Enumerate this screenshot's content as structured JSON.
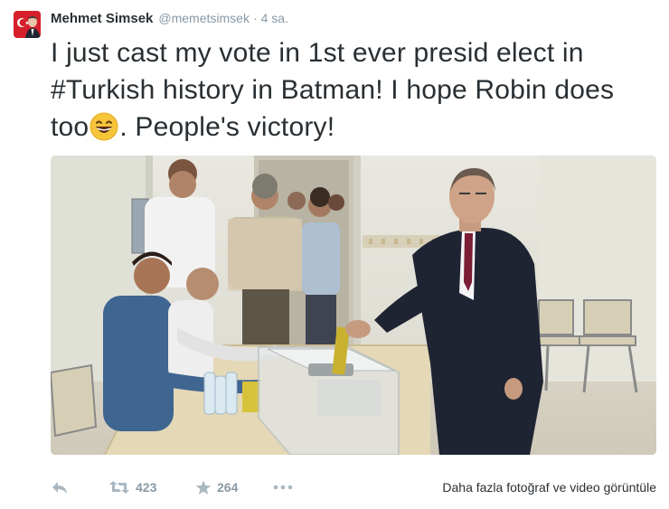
{
  "tweet": {
    "author_name": "Mehmet Simsek",
    "handle": "@memetsimsek",
    "separator": "·",
    "time": "4 sa.",
    "text_before_emoji": "I just cast my vote in 1st ever presid elect in #Turkish history in Batman! I hope Robin does too",
    "emoji": "grinning-face-emoji",
    "text_after_emoji": ". People's victory!"
  },
  "actions": {
    "reply_icon": "reply-icon",
    "retweet_icon": "retweet-icon",
    "retweet_count": "423",
    "favorite_icon": "star-icon",
    "favorite_count": "264",
    "more_icon": "more-icon",
    "more_media_link": "Daha fazla fotoğraf ve video görüntüle"
  },
  "colors": {
    "text": "#292f33",
    "muted": "#8899a6",
    "avatar_flag": "#d5202b"
  }
}
